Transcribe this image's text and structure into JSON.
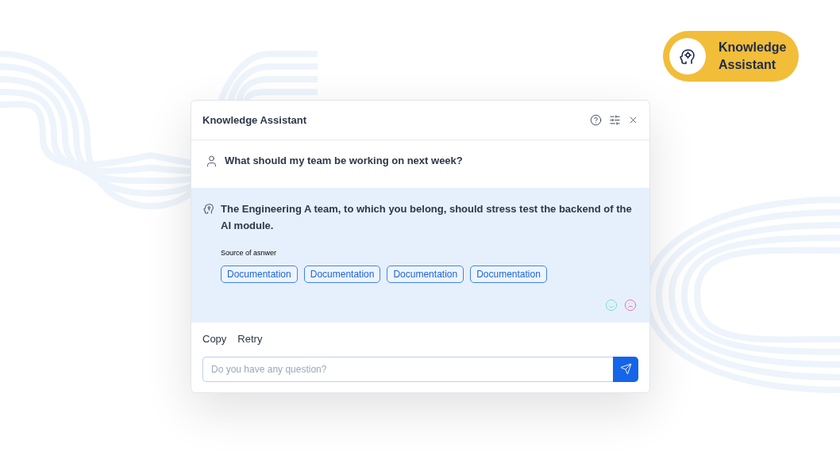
{
  "badge": {
    "label": "Knowledge Assistant"
  },
  "dialog": {
    "title": "Knowledge Assistant",
    "question": "What should my team be working on next week?",
    "answer": "The Engineering A team, to which you belong, should stress test the backend of the AI module.",
    "sources_label": "Source of asnwer",
    "sources": [
      "Documentation",
      "Documentation",
      "Documentation",
      "Documentation"
    ],
    "actions": [
      "Copy",
      "Retry"
    ],
    "input": {
      "placeholder": "Do you have any question?"
    }
  }
}
